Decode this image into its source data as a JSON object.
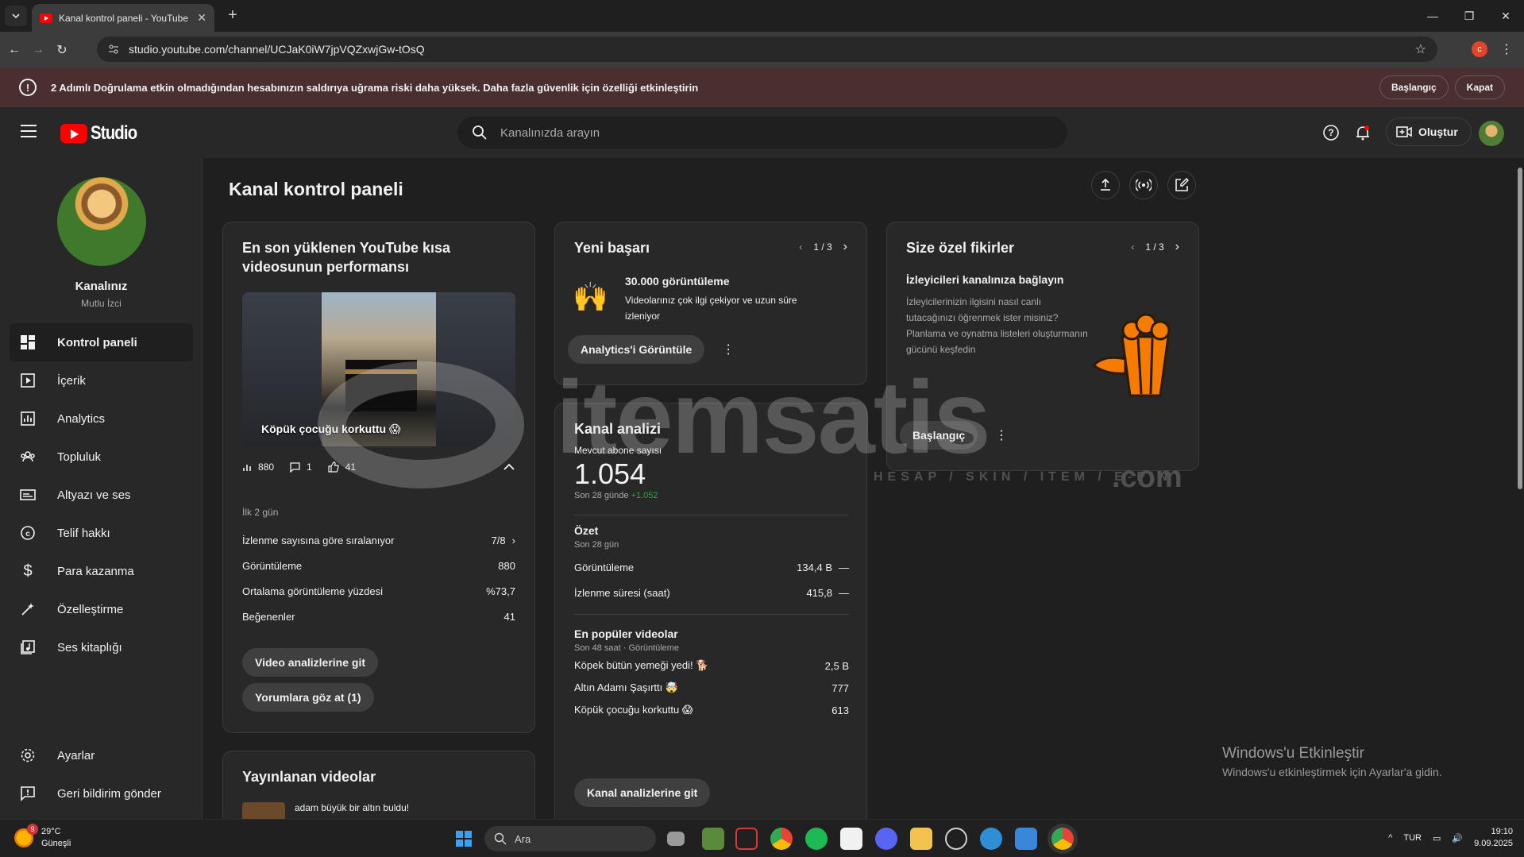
{
  "browser": {
    "tab_title": "Kanal kontrol paneli - YouTube",
    "url": "studio.youtube.com/channel/UCJaK0iW7jpVQZxwjGw-tOsQ",
    "profile_letter": "c"
  },
  "banner": {
    "text": "2 Adımlı Doğrulama etkin olmadığından hesabınızın saldırıya uğrama riski daha yüksek. Daha fazla güvenlik için özelliği etkinleştirin",
    "start_label": "Başlangıç",
    "close_label": "Kapat"
  },
  "header": {
    "logo_text": "Studio",
    "search_placeholder": "Kanalınızda arayın",
    "create_label": "Oluştur"
  },
  "sidebar": {
    "channel_name": "Kanalınız",
    "channel_handle": "Mutlu İzci",
    "items": [
      {
        "label": "Kontrol paneli",
        "icon": "dashboard-icon"
      },
      {
        "label": "İçerik",
        "icon": "content-icon"
      },
      {
        "label": "Analytics",
        "icon": "analytics-icon"
      },
      {
        "label": "Topluluk",
        "icon": "community-icon"
      },
      {
        "label": "Altyazı ve ses",
        "icon": "subtitles-icon"
      },
      {
        "label": "Telif hakkı",
        "icon": "copyright-icon"
      },
      {
        "label": "Para kazanma",
        "icon": "dollar-icon"
      },
      {
        "label": "Özelleştirme",
        "icon": "magic-wand-icon"
      },
      {
        "label": "Ses kitaplığı",
        "icon": "audio-library-icon"
      }
    ],
    "bottom_items": [
      {
        "label": "Ayarlar",
        "icon": "gear-icon"
      },
      {
        "label": "Geri bildirim gönder",
        "icon": "feedback-icon"
      }
    ]
  },
  "main": {
    "title": "Kanal kontrol paneli",
    "latest_short": {
      "title": "En son yüklenen YouTube kısa videosunun performansı",
      "caption": "Köpük çocuğu korkuttu 😱",
      "views": "880",
      "comments": "1",
      "likes": "41",
      "period": "İlk 2 gün",
      "rows": [
        {
          "label": "İzlenme sayısına göre sıralanıyor",
          "value": "7/8"
        },
        {
          "label": "Görüntüleme",
          "value": "880"
        },
        {
          "label": "Ortalama görüntüleme yüzdesi",
          "value": "%73,7"
        },
        {
          "label": "Beğenenler",
          "value": "41"
        }
      ],
      "btn_video": "Video analizlerine git",
      "btn_comments": "Yorumlara göz at (1)"
    },
    "published": {
      "title": "Yayınlanan videolar",
      "first_video": "adam büyük bir altın buldu!"
    },
    "achievement": {
      "title": "Yeni başarı",
      "pager": "1 / 3",
      "headline": "30.000 görüntüleme",
      "text": "Videolarınız çok ilgi çekiyor ve uzun süre izleniyor",
      "emoji": "🙌",
      "btn": "Analytics'i Görüntüle"
    },
    "analytics": {
      "title": "Kanal analizi",
      "subs_label": "Mevcut abone sayısı",
      "subs_value": "1.054",
      "subs_period": "Son 28 günde",
      "subs_delta": "+1.052",
      "summary_title": "Özet",
      "summary_period": "Son 28 gün",
      "summary_rows": [
        {
          "label": "Görüntüleme",
          "value": "134,4 B",
          "trend": "—"
        },
        {
          "label": "İzlenme süresi (saat)",
          "value": "415,8",
          "trend": "—"
        }
      ],
      "top_title": "En popüler videolar",
      "top_period": "Son 48 saat · Görüntüleme",
      "top_rows": [
        {
          "label": "Köpek bütün yemeği yedi! 🐕",
          "value": "2,5 B"
        },
        {
          "label": "Altın Adamı Şaşırttı 🤯",
          "value": "777"
        },
        {
          "label": "Köpük çocuğu korkuttu 😱",
          "value": "613"
        }
      ],
      "btn": "Kanal analizlerine git"
    },
    "ideas": {
      "title": "Size özel fikirler",
      "pager": "1 / 3",
      "headline": "İzleyicileri kanalınıza bağlayın",
      "text": "İzleyicilerinizin ilgisini nasıl canlı tutacağınızı öğrenmek ister misiniz? Planlama ve oynatma listeleri oluşturmanın gücünü keşfedin",
      "btn": "Başlangıç"
    }
  },
  "watermark": {
    "brand": "itemsatis",
    "sub": "HESAP / SKIN / ITEM / E-PIN",
    "dotcom": ".com"
  },
  "windows": {
    "activate_title": "Windows'u Etkinleştir",
    "activate_sub": "Windows'u etkinleştirmek için Ayarlar'a gidin."
  },
  "taskbar": {
    "temp": "29°C",
    "weather": "Güneşli",
    "weather_badge": "9",
    "search_label": "Ara",
    "lang": "TUR",
    "time": "19:10",
    "date": "9.09.2025"
  },
  "colors": {
    "brand_red": "#ff0000",
    "banner_bg": "#4a2f31",
    "delta_green": "#2ba640",
    "accent_orange": "#f57c00"
  }
}
